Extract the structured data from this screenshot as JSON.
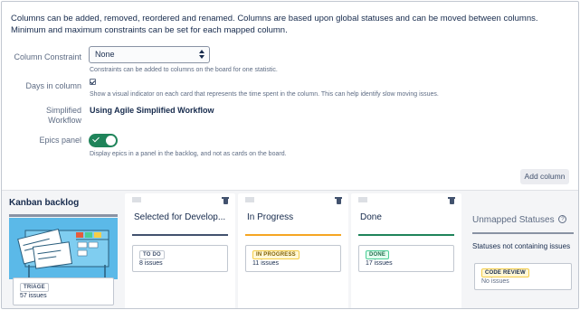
{
  "intro": "Columns can be added, removed, reordered and renamed. Columns are based upon global statuses and can be moved between columns. Minimum and maximum constraints can be set for each mapped column.",
  "settings": {
    "constraint_label": "Column Constraint",
    "constraint_value": "None",
    "constraint_help": "Constraints can be added to columns on the board for one statistic.",
    "days_label": "Days in column",
    "days_checked": true,
    "days_help": "Show a visual indicator on each card that represents the time spent in the column. This can help identify slow moving issues.",
    "simplified_label_line1": "Simplified",
    "simplified_label_line2": "Workflow",
    "simplified_value": "Using Agile Simplified Workflow",
    "epics_label": "Epics panel",
    "epics_enabled": true,
    "epics_help": "Display epics in a panel in the backlog, and not as cards on the board."
  },
  "add_column_label": "Add column",
  "backlog": {
    "title": "Kanban backlog",
    "status": "TRIAGE",
    "count": "57 issues"
  },
  "columns": [
    {
      "title": "Selected for Develop...",
      "status": "TO DO",
      "count": "8 issues",
      "color": "#42526e"
    },
    {
      "title": "In Progress",
      "status": "IN PROGRESS",
      "count": "11 issues",
      "color": "#f5a623"
    },
    {
      "title": "Done",
      "status": "DONE",
      "count": "17 issues",
      "color": "#1f845a"
    }
  ],
  "unmapped": {
    "title": "Unmapped Statuses",
    "help_icon": "?",
    "subtitle": "Statuses not containing issues",
    "status": "CODE REVIEW",
    "count": "No issues"
  }
}
